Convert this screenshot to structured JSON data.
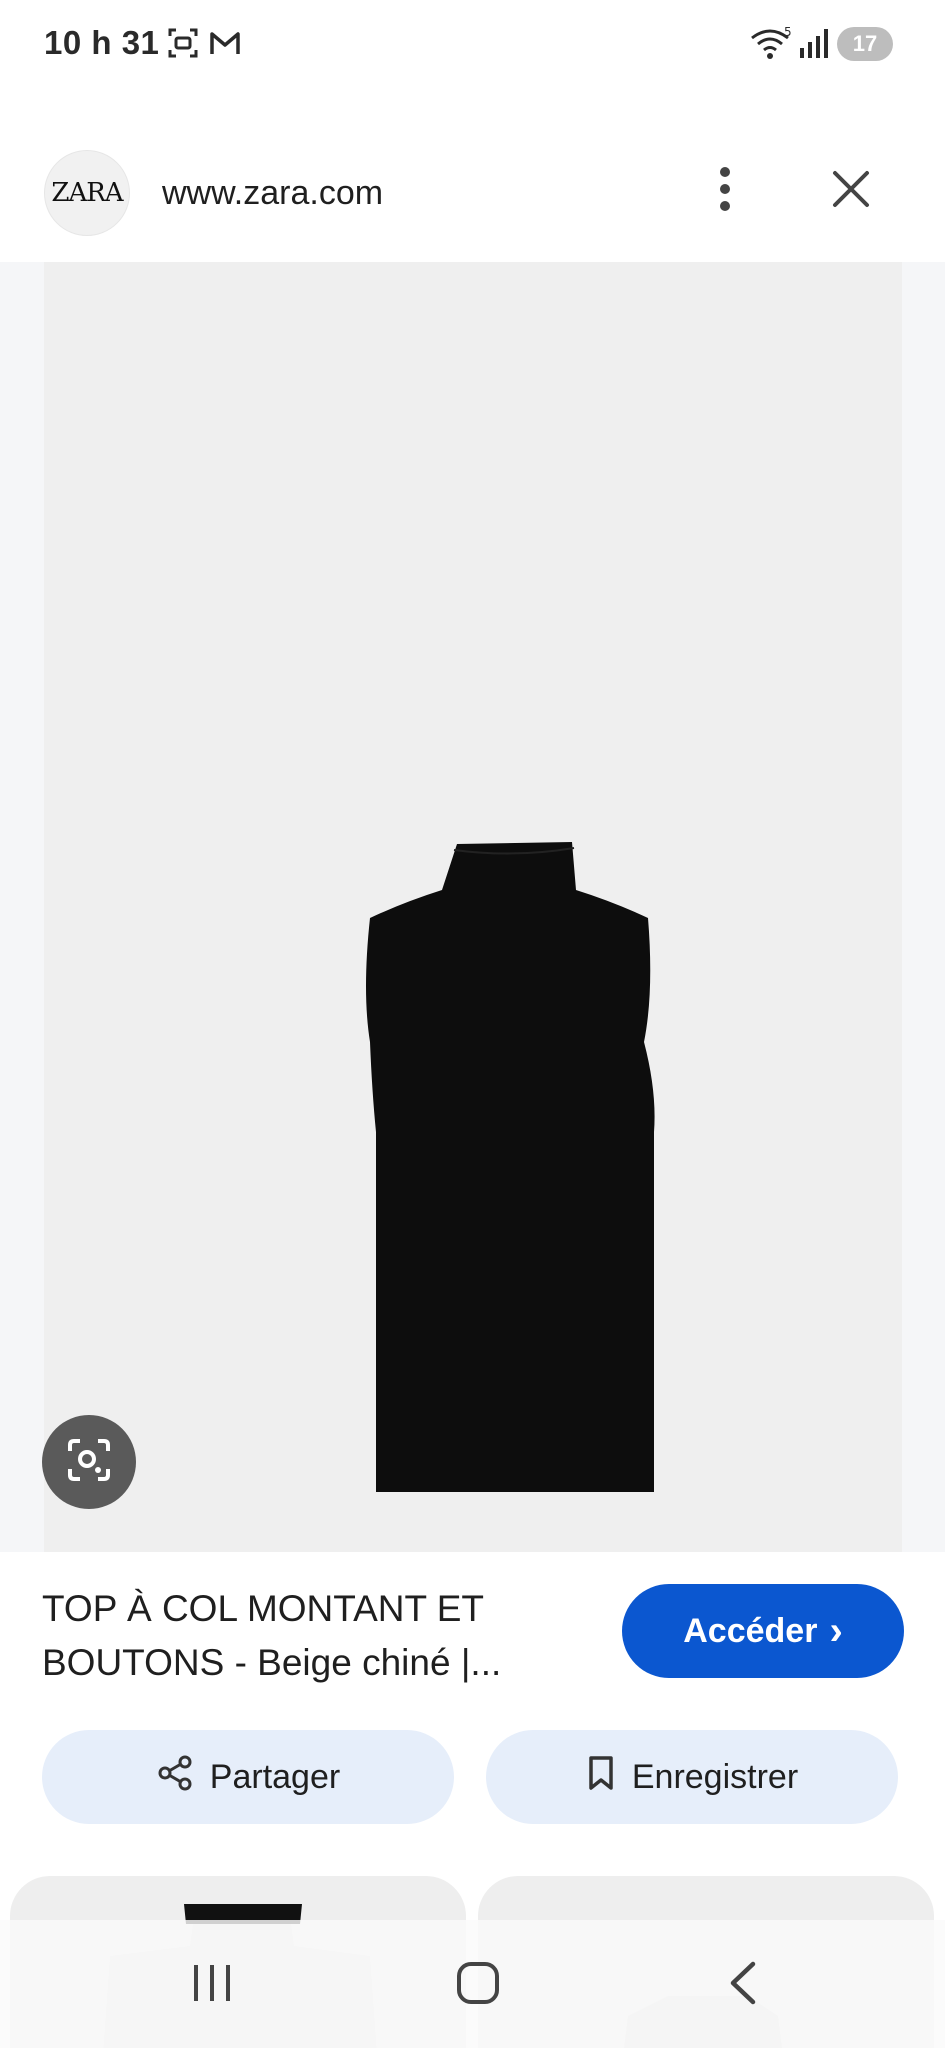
{
  "status": {
    "time": "10 h 31",
    "battery": "17"
  },
  "header": {
    "logo_text": "ZARA",
    "url": "www.zara.com"
  },
  "product": {
    "title": "TOP À COL MONTANT ET BOUTONS - Beige chiné |...",
    "open_label": "Accéder",
    "open_chevron": "›"
  },
  "actions": {
    "share_label": "Partager",
    "save_label": "Enregistrer"
  },
  "icons": {
    "screenshot": "screenshot-icon",
    "gmail": "gmail-icon",
    "wifi": "wifi-icon",
    "signal": "signal-icon",
    "more": "more-vert-icon",
    "close": "close-icon",
    "lens": "lens-icon",
    "share": "share-icon",
    "bookmark": "bookmark-icon",
    "recents": "recents-icon",
    "home": "home-icon",
    "back": "back-icon"
  },
  "colors": {
    "accent": "#0b57d0",
    "chip_bg": "#e6eefa",
    "panel_bg": "#efefef"
  }
}
